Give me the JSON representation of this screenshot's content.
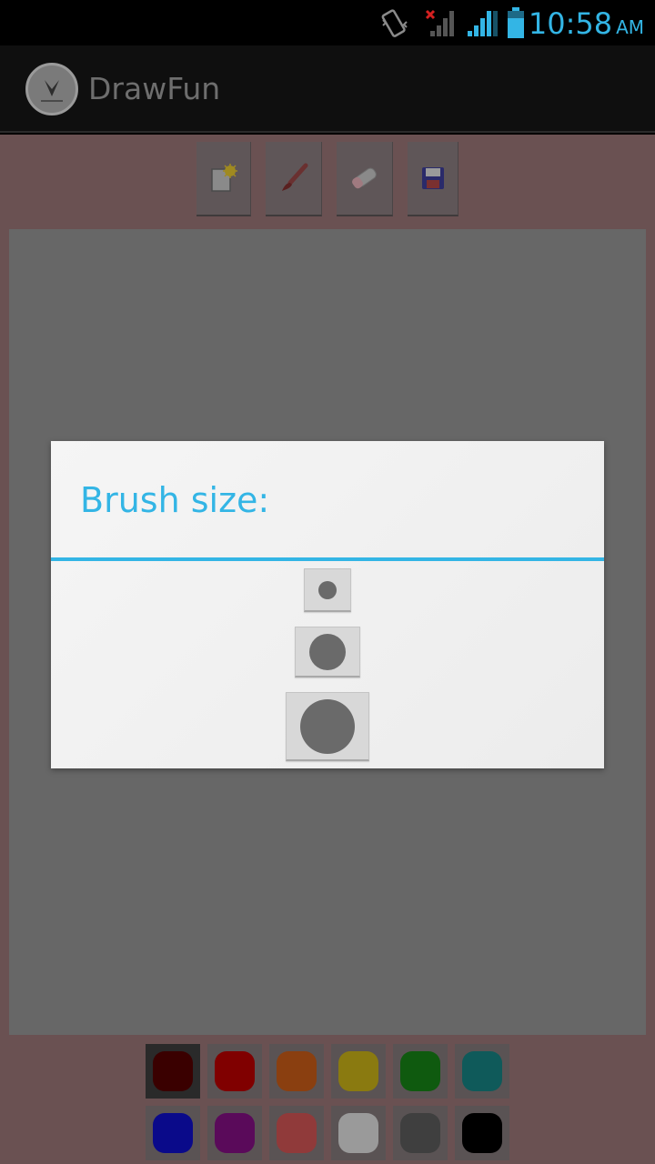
{
  "status_bar": {
    "time": "10:58",
    "ampm": "AM",
    "icons": [
      "vibrate-icon",
      "no-signal-icon",
      "signal-icon",
      "battery-icon"
    ]
  },
  "action_bar": {
    "title": "DrawFun",
    "icon": "app-logo-icon"
  },
  "toolbar": {
    "tools": [
      {
        "name": "new-drawing-button",
        "icon": "new-page-icon"
      },
      {
        "name": "brush-button",
        "icon": "brush-icon"
      },
      {
        "name": "eraser-button",
        "icon": "eraser-icon"
      },
      {
        "name": "save-button",
        "icon": "floppy-disk-icon"
      }
    ]
  },
  "dialog": {
    "title": "Brush size:",
    "options": [
      "small",
      "medium",
      "large"
    ]
  },
  "palette": {
    "colors": [
      "#3a0000",
      "#800000",
      "#8a3f10",
      "#8a7a10",
      "#0f5a0f",
      "#0f5a5a",
      "#0a0a8a",
      "#5a0a5a",
      "#903a3a",
      "#9a9a9a",
      "#3f3f3f",
      "#000000"
    ],
    "selected_index": 0
  },
  "colors": {
    "accent": "#33b5e5",
    "background": "#6a5152"
  }
}
